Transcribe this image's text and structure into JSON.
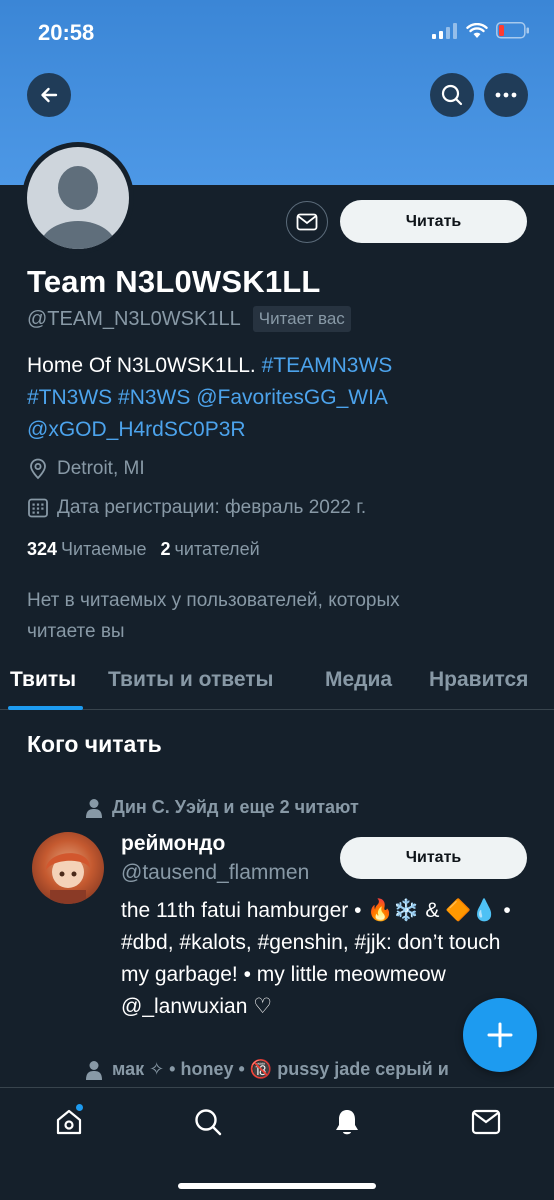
{
  "status_bar": {
    "time": "20:58"
  },
  "profile": {
    "name": "Team N3L0WSK1LL",
    "handle": "@TEAM_N3L0WSK1LL",
    "follows_you": "Читает вас",
    "bio_text": "Home Of N3L0WSK1LL. ",
    "bio_tag1": "#TEAMN3WS",
    "bio_tag2": "#TN3WS",
    "bio_tag3": "#N3WS",
    "bio_mention1": "@FavoritesGG_WIA",
    "bio_mention2": "@xGOD_H4rdSC0P3R",
    "location": "Detroit, MI",
    "joined": "Дата регистрации: февраль 2022 г.",
    "following_count": "324",
    "following_label": "Читаемые",
    "followers_count": "2",
    "followers_label": "читателей",
    "no_common": "Нет в читаемых у пользователей, которых читаете вы",
    "follow_button": "Читать"
  },
  "tabs": [
    {
      "label": "Твиты"
    },
    {
      "label": "Твиты и ответы"
    },
    {
      "label": "Медиа"
    },
    {
      "label": "Нравится"
    }
  ],
  "who_to_follow": {
    "title": "Кого читать",
    "items": [
      {
        "context": "Дин С. Уэйд и еще 2 читают",
        "name": "реймондо",
        "handle": "@tausend_flammen",
        "bio": "the 11th fatui hamburger • 🔥❄️ & 🔶💧 • #dbd, #kalots, #genshin, #jjk: don’t touch my garbage! • my little meowmeow @_lanwuxian ♡",
        "follow_button": "Читать"
      },
      {
        "context": "мак ✧ • honey • 🔞 pussy jade серый и"
      }
    ]
  },
  "colors": {
    "background": "#15202b",
    "banner": "#4d98e6",
    "accent": "#1d9bf0",
    "link": "#4ca3ec",
    "secondary_text": "#8899a6"
  },
  "icons": [
    "back-arrow-icon",
    "search-icon",
    "more-icon",
    "mail-icon",
    "location-icon",
    "calendar-icon",
    "person-icon",
    "plus-icon",
    "home-icon",
    "notifications-icon"
  ]
}
